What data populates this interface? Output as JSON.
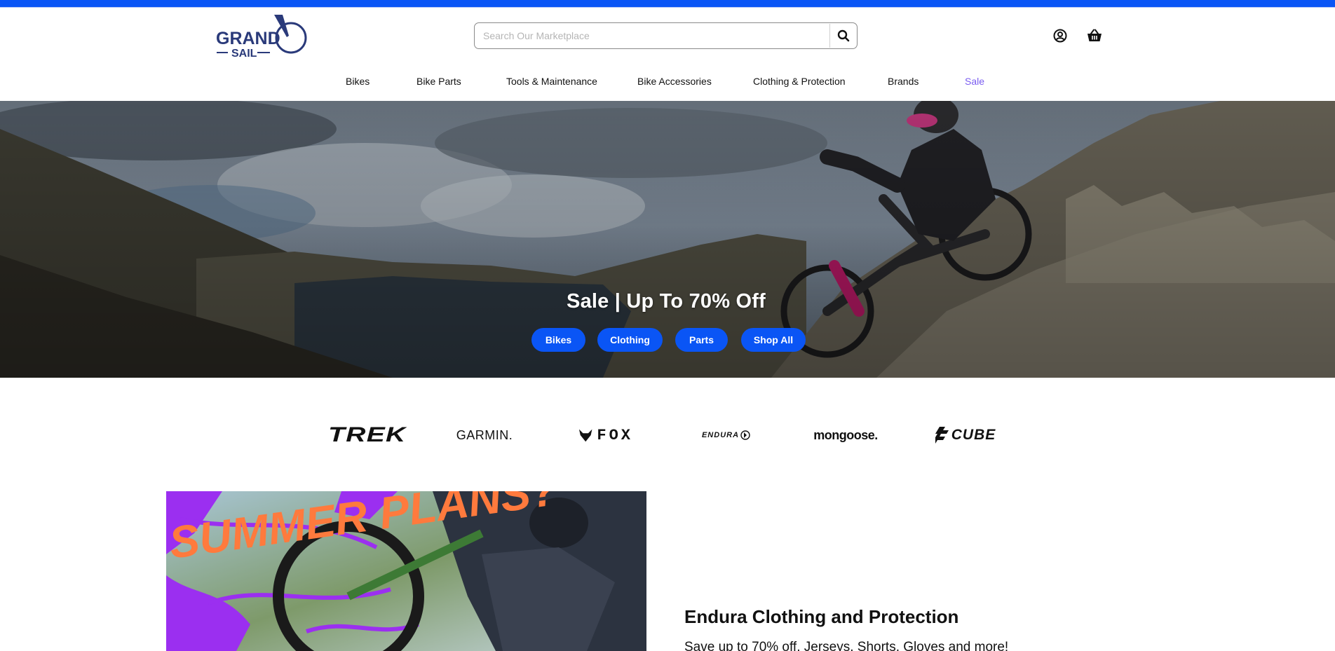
{
  "header": {
    "logo_top": "GRAND",
    "logo_bottom": "SAIL",
    "search_placeholder": "Search Our Marketplace",
    "icons": [
      "search-icon",
      "account-icon",
      "basket-icon"
    ]
  },
  "nav": {
    "items": [
      {
        "label": "Bikes"
      },
      {
        "label": "Bike Parts"
      },
      {
        "label": "Tools & Maintenance"
      },
      {
        "label": "Bike Accessories"
      },
      {
        "label": "Clothing & Protection"
      },
      {
        "label": "Brands"
      },
      {
        "label": "Sale"
      }
    ]
  },
  "hero": {
    "title": "Sale | Up To 70% Off",
    "buttons": [
      {
        "label": "Bikes"
      },
      {
        "label": "Clothing"
      },
      {
        "label": "Parts"
      },
      {
        "label": "Shop All"
      }
    ]
  },
  "brands": {
    "items": [
      {
        "label": "TREK"
      },
      {
        "label": "GARMIN."
      },
      {
        "label": "FOX"
      },
      {
        "label": "ENDURA"
      },
      {
        "label": "mongoose."
      },
      {
        "label": "CUBE"
      }
    ]
  },
  "promo": {
    "image_text": "SUMMER PLANS?",
    "title": "Endura Clothing and Protection",
    "text": "Save up to 70% off. Jerseys, Shorts, Gloves and more!"
  },
  "colors": {
    "accent": "#0a55f5",
    "sale": "#7a5cf0",
    "logo": "#2a3a7a",
    "promo_purple": "#9b2ff0",
    "promo_orange": "#ff7a3d"
  }
}
